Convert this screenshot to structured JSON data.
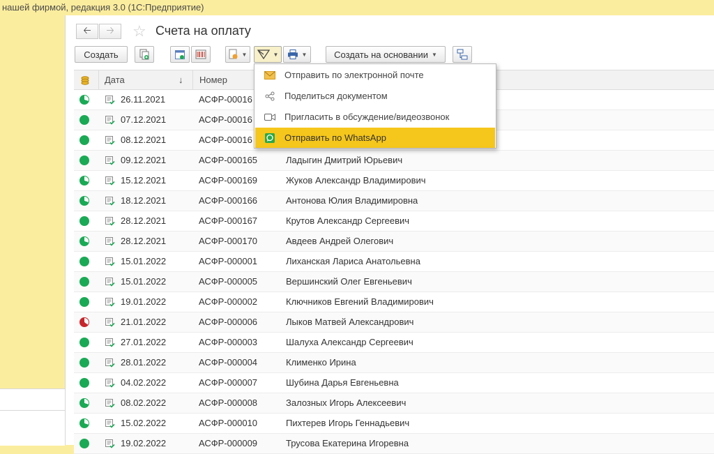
{
  "window": {
    "title": "нашей фирмой, редакция 3.0  (1С:Предприятие)"
  },
  "header": {
    "title": "Счета на оплату",
    "back_icon": "arrow-left-icon",
    "forward_icon": "arrow-right-icon",
    "favorite_icon": "star-icon"
  },
  "toolbar": {
    "create_label": "Создать",
    "create_based_label": "Создать на основании",
    "icons": [
      "copy-icon",
      "calendar-icon",
      "barcode-icon",
      "report-icon",
      "send-icon",
      "print-icon",
      "structure-icon"
    ]
  },
  "table": {
    "columns": {
      "date": "Дата",
      "sort": "↓",
      "number": "Номер"
    },
    "rows": [
      {
        "status": "partial",
        "date": "26.11.2021",
        "number": "АСФР-00016",
        "name": ""
      },
      {
        "status": "paid",
        "date": "07.12.2021",
        "number": "АСФР-00016",
        "name": ""
      },
      {
        "status": "paid",
        "date": "08.12.2021",
        "number": "АСФР-00016",
        "name": ""
      },
      {
        "status": "paid",
        "date": "09.12.2021",
        "number": "АСФР-000165",
        "name": "Ладыгин Дмитрий Юрьевич"
      },
      {
        "status": "partial",
        "date": "15.12.2021",
        "number": "АСФР-000169",
        "name": "Жуков Александр Владимирович"
      },
      {
        "status": "partial",
        "date": "18.12.2021",
        "number": "АСФР-000166",
        "name": "Антонова Юлия Владимировна"
      },
      {
        "status": "paid",
        "date": "28.12.2021",
        "number": "АСФР-000167",
        "name": "Крутов Александр Сергеевич"
      },
      {
        "status": "partial",
        "date": "28.12.2021",
        "number": "АСФР-000170",
        "name": "Авдеев Андрей Олегович"
      },
      {
        "status": "paid",
        "date": "15.01.2022",
        "number": "АСФР-000001",
        "name": "Лиханская Лариса Анатольевна"
      },
      {
        "status": "paid",
        "date": "15.01.2022",
        "number": "АСФР-000005",
        "name": "Вершинский Олег Евгеньевич"
      },
      {
        "status": "paid",
        "date": "19.01.2022",
        "number": "АСФР-000002",
        "name": "Ключников Евгений Владимирович"
      },
      {
        "status": "unpaid",
        "date": "21.01.2022",
        "number": "АСФР-000006",
        "name": "Лыков Матвей Александрович"
      },
      {
        "status": "paid",
        "date": "27.01.2022",
        "number": "АСФР-000003",
        "name": "Шалуха Александр Сергеевич"
      },
      {
        "status": "paid",
        "date": "28.01.2022",
        "number": "АСФР-000004",
        "name": "Клименко Ирина"
      },
      {
        "status": "paid",
        "date": "04.02.2022",
        "number": "АСФР-000007",
        "name": "Шубина Дарья Евгеньевна"
      },
      {
        "status": "partial",
        "date": "08.02.2022",
        "number": "АСФР-000008",
        "name": "Залозных Игорь Алексеевич"
      },
      {
        "status": "partial",
        "date": "15.02.2022",
        "number": "АСФР-000010",
        "name": "Пихтерев Игорь Геннадьевич"
      },
      {
        "status": "paid",
        "date": "19.02.2022",
        "number": "АСФР-000009",
        "name": "Трусова Екатерина Игоревна"
      }
    ]
  },
  "menu": {
    "items": [
      {
        "label": "Отправить по электронной почте",
        "icon": "envelope-icon"
      },
      {
        "label": "Поделиться документом",
        "icon": "share-icon"
      },
      {
        "label": "Пригласить в обсуждение/видеозвонок",
        "icon": "video-camera-icon"
      },
      {
        "label": "Отправить по WhatsApp",
        "icon": "whatsapp-icon"
      }
    ]
  },
  "colors": {
    "accent_yellow": "#f5c61b",
    "paid_green": "#1aaa55",
    "unpaid_red": "#c8262c",
    "titlebar": "#fbed9e"
  }
}
